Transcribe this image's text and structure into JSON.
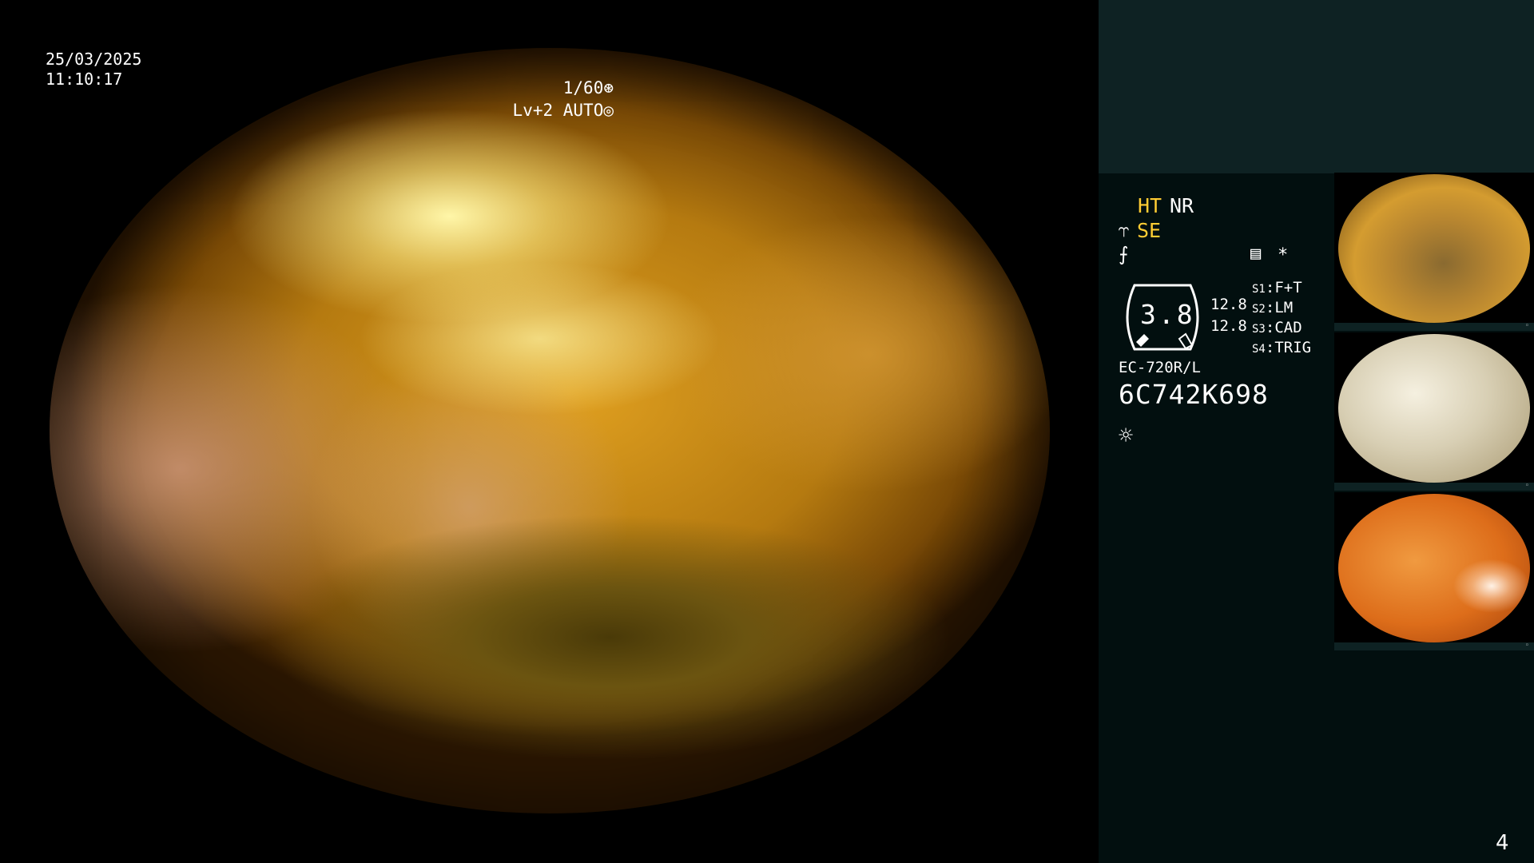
{
  "osd": {
    "date": "25/03/2025",
    "time": "11:10:17",
    "shutter": "1/60",
    "shutter_icon": "aperture-icon",
    "level": "Lv+2 AUTO",
    "level_icon": "iris-icon"
  },
  "panel": {
    "ht": "HT",
    "nr": "NR",
    "se": "SE",
    "se_icon": "structure-enhancement-icon",
    "wave_icon": "color-mode-icon",
    "menu_icon": "menu-icon",
    "star": "*",
    "gauge_value": "3.8",
    "value_1": "12.8",
    "value_2": "12.8",
    "switches": [
      {
        "key": "S1",
        "label": "F+T"
      },
      {
        "key": "S2",
        "label": "LM"
      },
      {
        "key": "S3",
        "label": "CAD"
      },
      {
        "key": "S4",
        "label": "TRIG"
      }
    ],
    "scope_model": "EC-720R/L",
    "serial": "6C742K698",
    "light_icon": "light-source-icon",
    "page_number": "4"
  },
  "thumbnails": [
    {
      "name": "capture-1"
    },
    {
      "name": "capture-2"
    },
    {
      "name": "capture-3"
    }
  ],
  "colors": {
    "yellow_accent": "#ffcc33",
    "panel_dark": "#020f0f",
    "panel_top": "#0e2223"
  }
}
